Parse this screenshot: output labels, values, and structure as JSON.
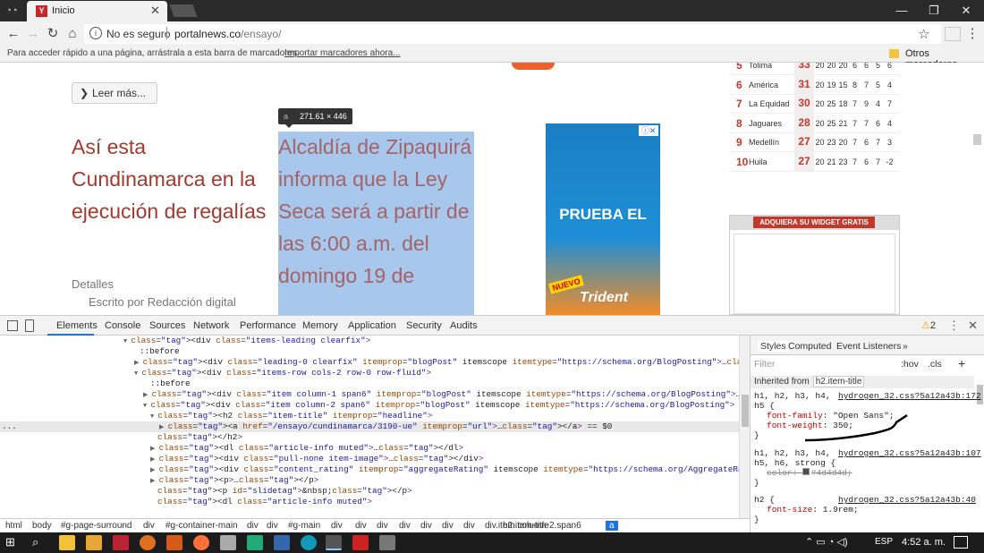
{
  "browser": {
    "incognito_icon": "incognito-icon",
    "tab_title": "Inicio",
    "tab_close": "✕",
    "window_buttons": [
      "—",
      "❐",
      "✕"
    ],
    "nav": {
      "back": "←",
      "forward": "→",
      "reload": "↻",
      "home": "⌂"
    },
    "security_text": "No es seguro",
    "url_host": "portalnews.co",
    "url_path": "/ensayo/",
    "star": "☆",
    "menu": "⋮",
    "bookmarks_hint": "Para acceder rápido a una página, arrástrala a esta barra de marcadores.",
    "bookmarks_import": "Importar marcadores ahora...",
    "other_bookmarks": "Otros marcadores"
  },
  "page": {
    "read_more": "Leer más...",
    "headline_left": "Así esta Cundinamarca en la ejecución de regalías",
    "details_label": "Detalles",
    "author": "Escrito por Redacción digital",
    "headline_right": "Alcaldía de Zipaquirá informa que la Ley Seca será a partir de las 6:00 a.m. del domingo 19 de",
    "inspect_tooltip": {
      "tag": "a",
      "size": "271.61 × 446"
    },
    "ad": {
      "title": "PRUEBA EL",
      "badge": "NUEVO",
      "brand": "Trident"
    },
    "standings": [
      {
        "pos": "5",
        "team": "Tolima",
        "pts": "33",
        "cells": [
          "20",
          "20",
          "20",
          "6",
          "6",
          "5",
          "6"
        ]
      },
      {
        "pos": "6",
        "team": "América",
        "pts": "31",
        "cells": [
          "20",
          "19",
          "15",
          "8",
          "7",
          "5",
          "4"
        ]
      },
      {
        "pos": "7",
        "team": "La Equidad",
        "pts": "30",
        "cells": [
          "20",
          "25",
          "18",
          "7",
          "9",
          "4",
          "7"
        ]
      },
      {
        "pos": "8",
        "team": "Jaguares",
        "pts": "28",
        "cells": [
          "20",
          "25",
          "21",
          "7",
          "7",
          "6",
          "4"
        ]
      },
      {
        "pos": "9",
        "team": "Medellín",
        "pts": "27",
        "cells": [
          "20",
          "23",
          "20",
          "7",
          "6",
          "7",
          "3"
        ]
      },
      {
        "pos": "10",
        "team": "Huila",
        "pts": "27",
        "cells": [
          "20",
          "21",
          "23",
          "7",
          "6",
          "7",
          "-2"
        ]
      }
    ],
    "widget_button": "ADQUIERA SU WIDGET GRATIS"
  },
  "devtools": {
    "tabs": [
      "Elements",
      "Console",
      "Sources",
      "Network",
      "Performance",
      "Memory",
      "Application",
      "Security",
      "Audits"
    ],
    "warnings": "2",
    "dom_lines": [
      {
        "indent": 138,
        "arrow": "▼",
        "html": "<div class=\"items-leading clearfix\">"
      },
      {
        "indent": 156,
        "arrow": "",
        "html": "::before"
      },
      {
        "indent": 150,
        "arrow": "▶",
        "html": "<div class=\"leading-0 clearfix\" itemprop=\"blogPost\" itemscope itemtype=\"https://schema.org/BlogPosting\">…</div>"
      },
      {
        "indent": 150,
        "arrow": "▼",
        "html": "<div class=\"items-row cols-2 row-0 row-fluid\">"
      },
      {
        "indent": 168,
        "arrow": "",
        "html": "::before"
      },
      {
        "indent": 160,
        "arrow": "▶",
        "html": "<div class=\"item column-1 span6\" itemprop=\"blogPost\" itemscope itemtype=\"https://schema.org/BlogPosting\">…</div>"
      },
      {
        "indent": 160,
        "arrow": "▼",
        "html": "<div class=\"item column-2 span6\" itemprop=\"blogPost\" itemscope itemtype=\"https://schema.org/BlogPosting\">"
      },
      {
        "indent": 168,
        "arrow": "▼",
        "html": "<h2 class=\"item-title\" itemprop=\"headline\">"
      },
      {
        "indent": 178,
        "arrow": "▶",
        "html": "<a href=\"/ensayo/cundinamarca/3190-ue\" itemprop=\"url\">…</a> == $0"
      },
      {
        "indent": 176,
        "arrow": "",
        "html": "</h2>"
      },
      {
        "indent": 168,
        "arrow": "▶",
        "html": "<dl class=\"article-info muted\">…</dl>"
      },
      {
        "indent": 168,
        "arrow": "▶",
        "html": "<div class=\"pull-none item-image\">…</div>"
      },
      {
        "indent": 168,
        "arrow": "▶",
        "html": "<div class=\"content_rating\" itemprop=\"aggregateRating\" itemscope itemtype=\"https://schema.org/AggregateRating\">…</div>"
      },
      {
        "indent": 168,
        "arrow": "▶",
        "html": "<p>…</p>"
      },
      {
        "indent": 176,
        "arrow": "",
        "html": "<p id=\"slidetag\">&nbsp;</p>"
      },
      {
        "indent": 176,
        "arrow": "",
        "html": "<dl class=\"article-info muted\">"
      }
    ],
    "selected_line": 8,
    "breadcrumb": [
      "html",
      "body",
      "#g-page-surround",
      "div",
      "#g-container-main",
      "div",
      "div",
      "#g-main",
      "div",
      "div",
      "div",
      "div",
      "div",
      "div",
      "div",
      "div.item.column-2.span6",
      "h2.item-title",
      "a"
    ],
    "styles_tabs": [
      "Styles",
      "Computed",
      "Event Listeners",
      "»"
    ],
    "filter_placeholder": "Filter",
    "hov": ":hov",
    "cls": ".cls",
    "plus": "+",
    "inherited_label": "Inherited from",
    "inherited_tag": "h2.item-title",
    "rules": [
      {
        "selector1": "h1, h2, h3, h4,",
        "selector2": "h5 {",
        "source": "hydrogen_32.css?5a12a43b:172",
        "decls": [
          {
            "prop": "font-family",
            "val": "\"Open Sans\";"
          },
          {
            "prop": "font-weight",
            "val": "350;"
          }
        ]
      },
      {
        "selector1": "h1, h2, h3, h4,",
        "selector2": "h5, h6, strong {",
        "source": "hydrogen_32.css?5a12a43b:107",
        "decls": [
          {
            "prop": "color",
            "val": "#4d4d4d;"
          }
        ]
      },
      {
        "selector1": "h2 {",
        "selector2": "",
        "source": "hydrogen_32.css?5a12a43b:40",
        "decls": [
          {
            "prop": "font-size",
            "val": "1.9rem;"
          }
        ]
      }
    ],
    "close_brace": "}"
  },
  "taskbar": {
    "lang": "ESP",
    "time": "4:52 a. m.",
    "tray": "⌃ ▭ ◔ ◁)"
  }
}
